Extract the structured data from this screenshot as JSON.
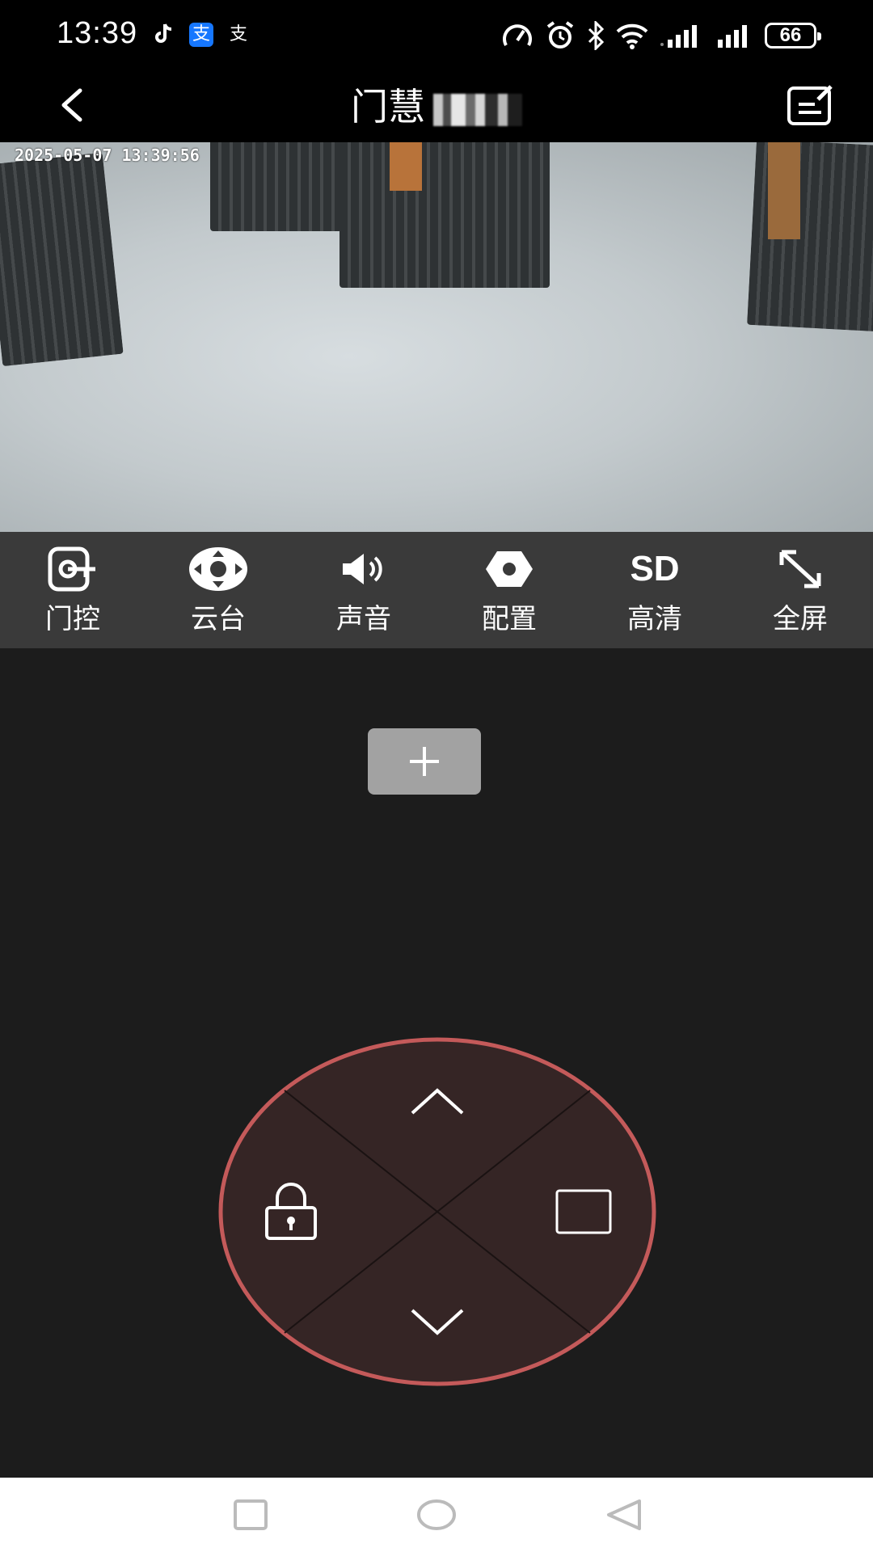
{
  "status_bar": {
    "time": "13:39",
    "app_icons": [
      "tiktok-icon",
      "alipay-icon",
      "alipay-icon"
    ],
    "alipay_glyph": "支",
    "battery": "66"
  },
  "header": {
    "title": "门慧"
  },
  "video": {
    "timestamp": "2025-05-07 13:39:56"
  },
  "toolbar": {
    "items": [
      {
        "label": "门控",
        "icon": "door-control-icon"
      },
      {
        "label": "云台",
        "icon": "ptz-icon"
      },
      {
        "label": "声音",
        "icon": "speaker-icon"
      },
      {
        "label": "配置",
        "icon": "settings-hex-icon"
      },
      {
        "label": "高清",
        "icon": "sd-icon",
        "icon_text": "SD"
      },
      {
        "label": "全屏",
        "icon": "fullscreen-icon"
      }
    ]
  },
  "add_button": {
    "icon": "plus-icon"
  },
  "control_pad": {
    "ring_color": "#c45a5a",
    "fill_color": "#352525",
    "zones": [
      "up-arrow-icon",
      "lock-icon",
      "square-icon",
      "down-arrow-icon"
    ]
  },
  "nav_bar": {
    "buttons": [
      "recents-icon",
      "home-icon",
      "back-icon"
    ]
  }
}
